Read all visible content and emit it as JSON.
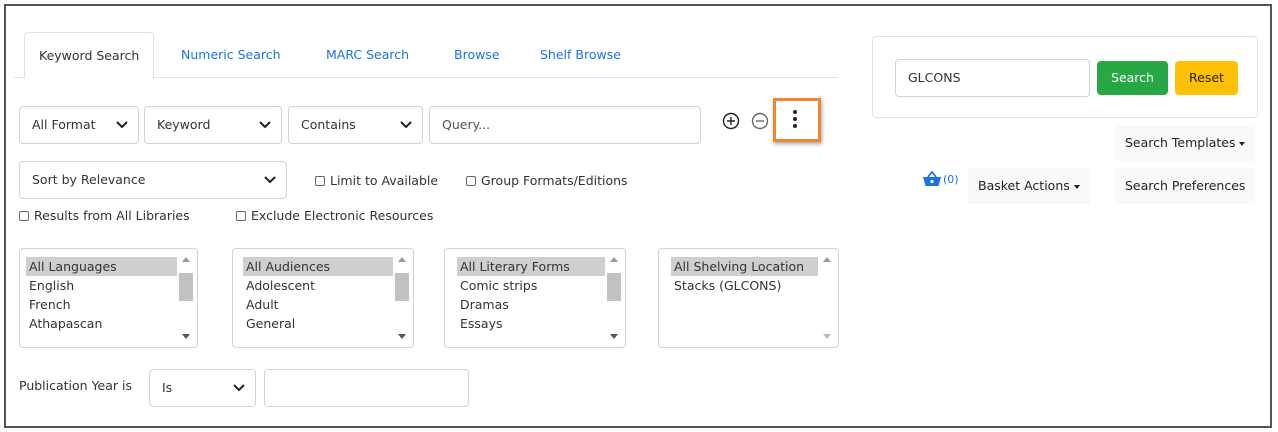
{
  "tabs": [
    "Keyword Search",
    "Numeric Search",
    "MARC Search",
    "Browse",
    "Shelf Browse"
  ],
  "query_row": {
    "format": "All Format",
    "field": "Keyword",
    "match": "Contains",
    "query_placeholder": "Query..."
  },
  "sort": {
    "value": "Sort by Relevance"
  },
  "checkboxes": {
    "limit_available": "Limit to Available",
    "group_formats": "Group Formats/Editions",
    "all_libraries": "Results from All Libraries",
    "exclude_electronic": "Exclude Electronic Resources"
  },
  "filters": {
    "languages": [
      "All Languages",
      "English",
      "French",
      "Athapascan"
    ],
    "audiences": [
      "All Audiences",
      "Adolescent",
      "Adult",
      "General"
    ],
    "literary_forms": [
      "All Literary Forms",
      "Comic strips",
      "Dramas",
      "Essays"
    ],
    "shelving": [
      "All Shelving Location",
      "Stacks (GLCONS)"
    ]
  },
  "pub_year": {
    "label": "Publication Year is",
    "operator": "Is",
    "value": ""
  },
  "right_panel": {
    "search_value": "GLCONS",
    "search_button": "Search",
    "reset_button": "Reset",
    "search_templates": "Search Templates",
    "basket_count": "(0)",
    "basket_actions": "Basket Actions",
    "search_preferences": "Search Preferences"
  },
  "colors": {
    "accent_link": "#1a73e8",
    "search_green": "#28a745",
    "reset_yellow": "#ffc107",
    "highlight_orange": "#f0862e",
    "basket_blue": "#1a73e8"
  }
}
